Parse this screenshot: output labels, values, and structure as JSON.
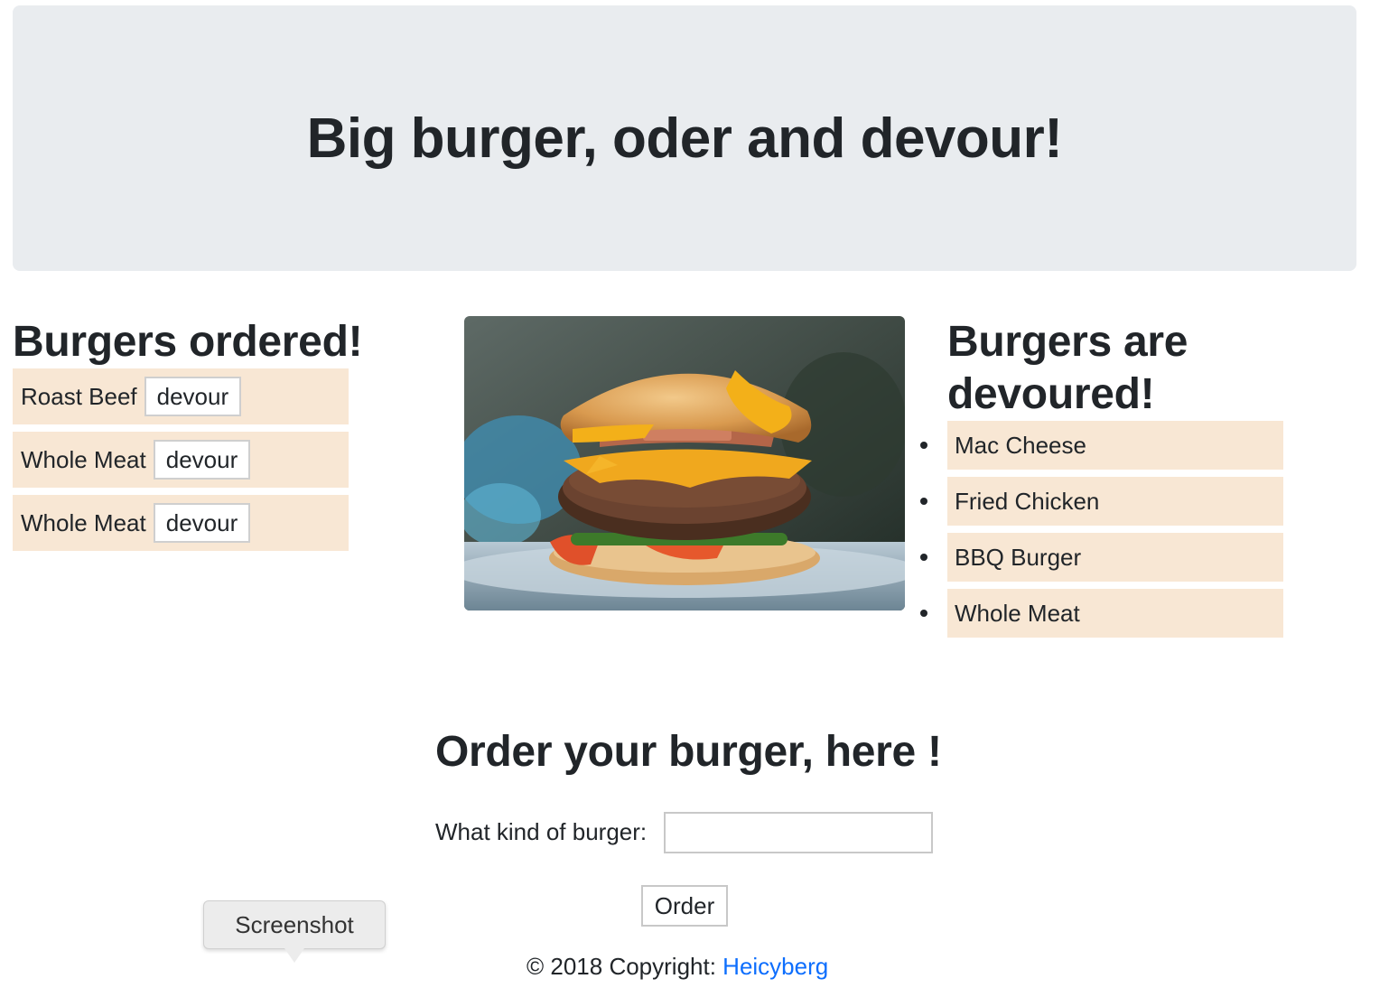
{
  "header": {
    "title": "Big burger, oder and devour!"
  },
  "ordered": {
    "title": "Burgers ordered!",
    "items": [
      {
        "name": "Roast Beef",
        "button": "devour"
      },
      {
        "name": "Whole Meat",
        "button": "devour"
      },
      {
        "name": "Whole Meat",
        "button": "devour"
      }
    ]
  },
  "devoured": {
    "title_line1": "Burgers are",
    "title_line2": "devoured!",
    "items": [
      "Mac Cheese",
      "Fried Chicken",
      "BBQ Burger",
      "Whole Meat"
    ]
  },
  "image": {
    "icon": "burger-photo"
  },
  "order_form": {
    "title": "Order your burger, here !",
    "label": "What kind of burger:",
    "input_value": "",
    "submit_label": "Order"
  },
  "footer": {
    "text": "© 2018 Copyright: ",
    "link": "Heicyberg"
  },
  "tooltip": {
    "text": "Screenshot"
  },
  "colors": {
    "jumbotron": "#e9ecef",
    "item_bg": "#f8e7d4",
    "link": "#0d6efd",
    "text": "#212529"
  }
}
